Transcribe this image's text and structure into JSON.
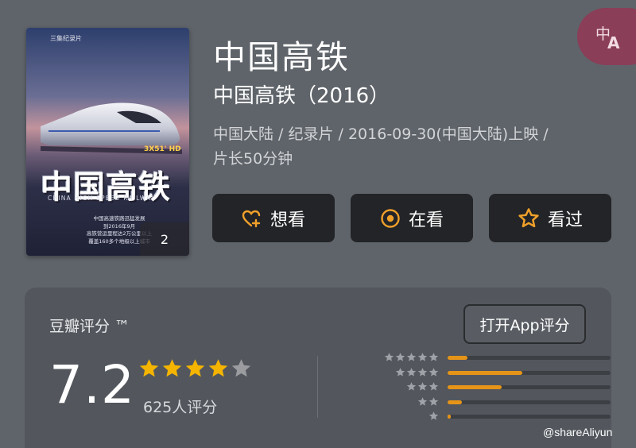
{
  "poster": {
    "top_caption": "三集纪录片",
    "hd_label": "3X51' HD",
    "title": "中国高铁",
    "subtitle": "CHINA HIGH SPEED RAILWAY",
    "description": [
      "中国高速铁路迅猛发展",
      "到2016年9月",
      "高铁营运里程达2万公里以上",
      "覆盖160多个地级以上城市"
    ],
    "photo_count": "2"
  },
  "title": "中国高铁",
  "subtitle": "中国高铁（2016）",
  "meta": {
    "line1": "中国大陆 / 纪录片 / 2016-09-30(中国大陆)上映 /",
    "line2": "片长50分钟"
  },
  "actions": {
    "want": "想看",
    "doing": "在看",
    "done": "看过"
  },
  "translate": {
    "icon": "translate-icon"
  },
  "rating": {
    "label": "豆瓣评分 ™",
    "open_app": "打开App评分",
    "score": "7.2",
    "stars": 4,
    "count_text": "625人评分",
    "distribution": [
      {
        "stars": 5,
        "value": 0.12
      },
      {
        "stars": 4,
        "value": 0.46
      },
      {
        "stars": 3,
        "value": 0.33
      },
      {
        "stars": 2,
        "value": 0.09
      },
      {
        "stars": 1,
        "value": 0.02
      }
    ]
  },
  "colors": {
    "accent": "#e69418",
    "star": "#f4b400",
    "star_empty": "#9a9ca0",
    "button_bg": "#232427",
    "translate_bg": "#8a3e57"
  },
  "watermark": "@shareAliyun"
}
